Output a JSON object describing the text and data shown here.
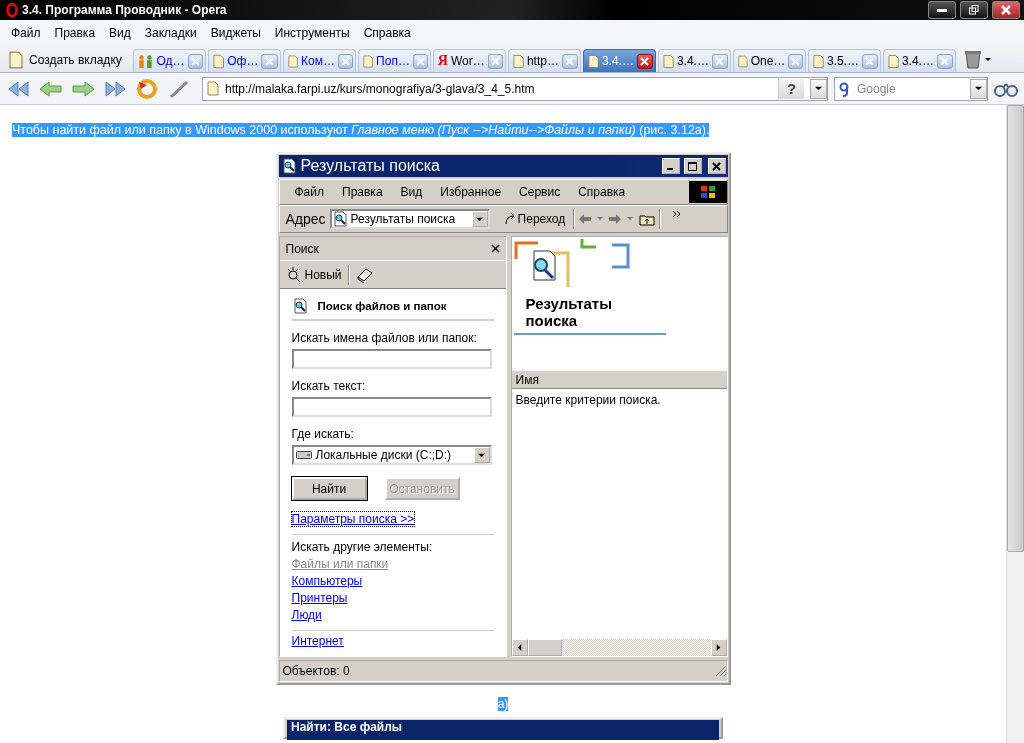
{
  "browser": {
    "title": "3.4. Программа Проводник - Opera",
    "menu": [
      "Файл",
      "Правка",
      "Вид",
      "Закладки",
      "Виджеты",
      "Инструменты",
      "Справка"
    ],
    "new_tab": "Создать вкладку",
    "tabs": [
      {
        "label": "Од…",
        "kind": "people",
        "pending": true,
        "selected": false
      },
      {
        "label": "Оф…",
        "kind": "page",
        "pending": true,
        "selected": false
      },
      {
        "label": "Ком…",
        "kind": "page",
        "pending": true,
        "selected": false
      },
      {
        "label": "Поп…",
        "kind": "page",
        "pending": true,
        "selected": false
      },
      {
        "label": "Wor…",
        "kind": "letter",
        "glyph": "Я",
        "pending": false,
        "selected": false
      },
      {
        "label": "http…",
        "kind": "page",
        "pending": false,
        "selected": false
      },
      {
        "label": "3.4.…",
        "kind": "page",
        "pending": false,
        "selected": true
      },
      {
        "label": "3.4.…",
        "kind": "page",
        "pending": false,
        "selected": false
      },
      {
        "label": "One…",
        "kind": "page",
        "pending": false,
        "selected": false
      },
      {
        "label": "3.5.…",
        "kind": "page",
        "pending": false,
        "selected": false
      },
      {
        "label": "3.4.…",
        "kind": "page",
        "pending": false,
        "selected": false
      }
    ],
    "address": "http://malaka.farpi.uz/kurs/monografiya/3-glava/3_4_5.htm",
    "help_button": "?",
    "search_placeholder": "Google"
  },
  "page": {
    "paragraph": "Чтобы найти файл или папку в Windows 2000 используют *Главное меню (Пуск -->Найти-->Файлы и папки)* (рис. 3.12а).",
    "figure": {
      "title": "Результаты поиска",
      "menu": [
        "Файл",
        "Правка",
        "Вид",
        "Избранное",
        "Сервис",
        "Справка"
      ],
      "address_label": "Адрес",
      "address_value": "Результаты поиска",
      "go_button": "Переход",
      "search_pane": {
        "title": "Поиск",
        "new_button": "Новый",
        "heading": "Поиск файлов и папок",
        "fields": [
          {
            "label": "Искать имена файлов или папок:"
          },
          {
            "label": "Искать текст:"
          }
        ],
        "location_label": "Где искать:",
        "location": "Локальные диски (C:;D:)",
        "buttons": [
          {
            "label": "Найти",
            "disabled": false
          },
          {
            "label": "Остановить",
            "disabled": true
          }
        ],
        "options_link": "Параметры поиска >>",
        "other_label": "Искать другие элементы:",
        "other_links": [
          {
            "label": "Файлы или папки",
            "disabled": true
          },
          {
            "label": "Компьютеры",
            "disabled": false
          },
          {
            "label": "Принтеры",
            "disabled": false
          },
          {
            "label": "Люди",
            "disabled": false
          }
        ],
        "internet_link": "Интернет"
      },
      "results": {
        "heading": "Результаты поиска",
        "column": "Имя",
        "message": "Введите критерии поиска."
      },
      "status": "Объектов: 0"
    },
    "caption": "а)",
    "next_window_title": "Найти: Все файлы"
  }
}
